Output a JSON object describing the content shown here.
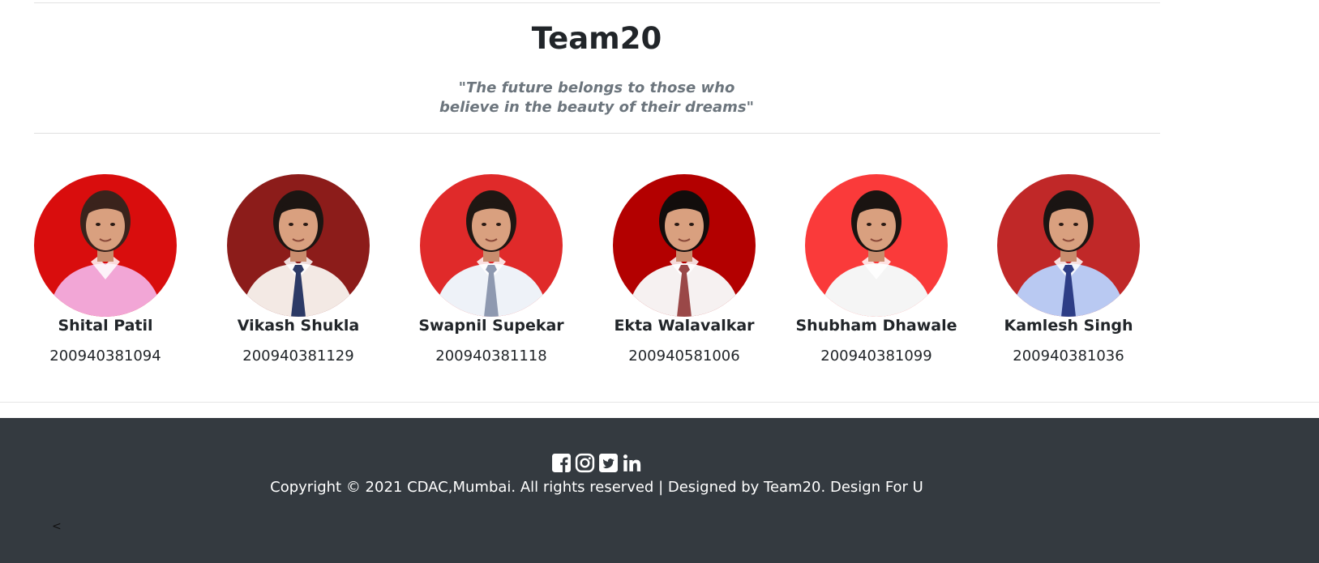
{
  "header": {
    "title": "Team20",
    "quote_line1": "\"The future belongs to those who",
    "quote_line2": "believe in the beauty of their dreams\""
  },
  "members": [
    {
      "name": "Shital Patil",
      "id": "200940381094",
      "bg": "#d90d0d",
      "shirt": "#f2a6d6",
      "tie": "none",
      "hair": "#3a231c"
    },
    {
      "name": "Vikash Shukla",
      "id": "200940381129",
      "bg": "#8c1c1a",
      "shirt": "#f3e9e4",
      "tie": "#2c3a66",
      "hair": "#1c1512"
    },
    {
      "name": "Swapnil Supekar",
      "id": "200940381118",
      "bg": "#e02a2a",
      "shirt": "#eef2f8",
      "tie": "#8e99b0",
      "hair": "#1f1713"
    },
    {
      "name": "Ekta Walavalkar",
      "id": "200940581006",
      "bg": "#b30000",
      "shirt": "#f6f1f1",
      "tie": "#9a4848",
      "hair": "#120d0c"
    },
    {
      "name": "Shubham Dhawale",
      "id": "200940381099",
      "bg": "#fa3a3a",
      "shirt": "#f5f5f5",
      "tie": "none",
      "hair": "#1a1411"
    },
    {
      "name": "Kamlesh Singh",
      "id": "200940381036",
      "bg": "#c02828",
      "shirt": "#b9c9f2",
      "tie": "#2d3d86",
      "hair": "#1a1513"
    }
  ],
  "footer": {
    "social_icons": [
      "facebook-icon",
      "instagram-icon",
      "twitter-icon",
      "linkedin-icon"
    ],
    "copyright": "Copyright © 2021 CDAC,Mumbai. All rights reserved | Designed by Team20. Design For U",
    "back_symbol": "<"
  },
  "colors": {
    "footer_bg": "#343a40",
    "quote": "#6c757d",
    "text": "#212529"
  }
}
